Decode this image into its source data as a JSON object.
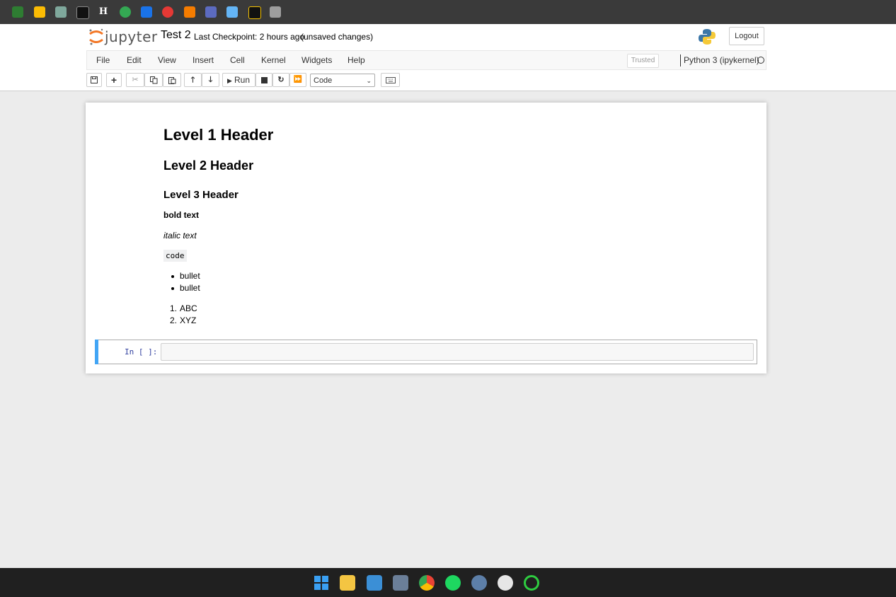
{
  "header": {
    "logo_text": "jupyter",
    "notebook_title": "Test 2",
    "checkpoint": "Last Checkpoint: 2 hours ago",
    "unsaved": "(unsaved changes)",
    "logout_label": "Logout"
  },
  "menu": {
    "items": [
      "File",
      "Edit",
      "View",
      "Insert",
      "Cell",
      "Kernel",
      "Widgets",
      "Help"
    ],
    "trusted": "Trusted",
    "kernel": "Python 3 (ipykernel)"
  },
  "toolbar": {
    "run_label": "Run",
    "cell_type": "Code"
  },
  "markdown": {
    "h1": "Level 1 Header",
    "h2": "Level 2 Header",
    "h3": "Level 3 Header",
    "bold": "bold text",
    "italic": "italic text",
    "code": "code",
    "bullets": [
      "bullet",
      "bullet"
    ],
    "numbered": [
      "ABC",
      "XYZ"
    ]
  },
  "code_cell": {
    "prompt": "In [ ]:"
  }
}
